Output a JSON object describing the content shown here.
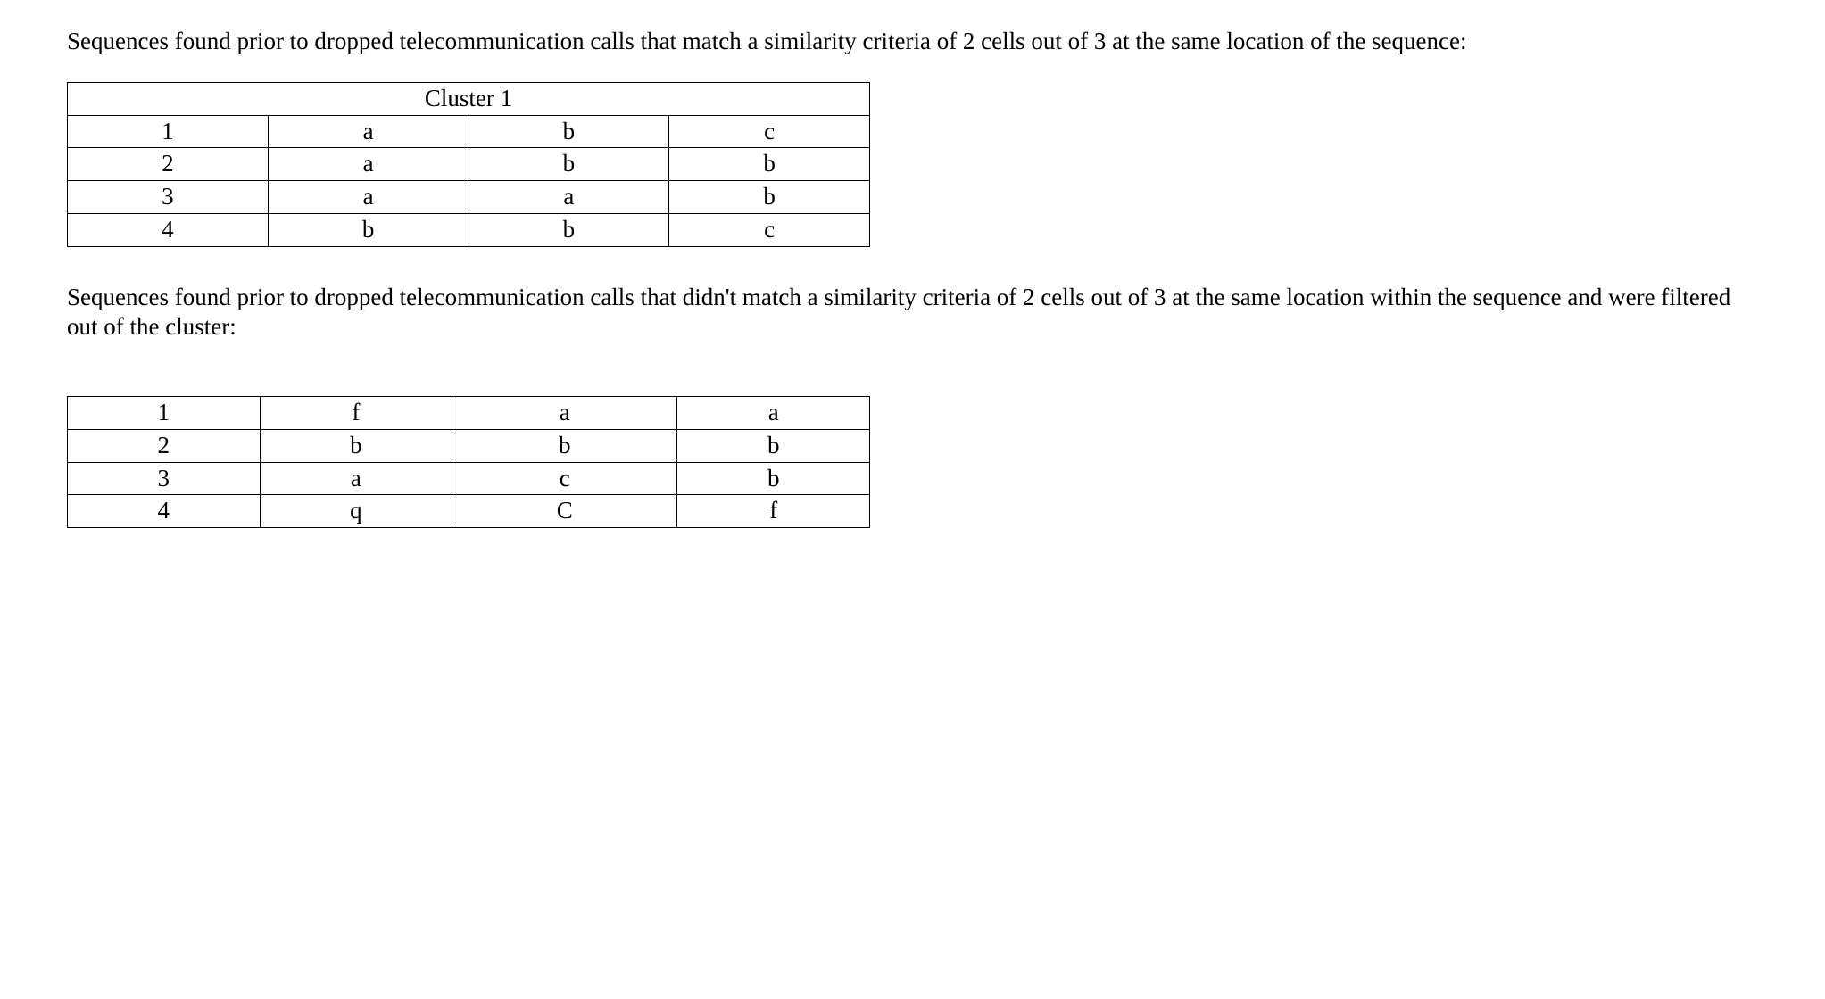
{
  "paragraph1": "Sequences found prior to dropped telecommunication calls that match a similarity criteria of 2 cells out of 3 at the same location of the sequence:",
  "table1": {
    "header": "Cluster 1",
    "rows": [
      [
        "1",
        "a",
        "b",
        "c"
      ],
      [
        "2",
        "a",
        "b",
        "b"
      ],
      [
        "3",
        "a",
        "a",
        "b"
      ],
      [
        "4",
        "b",
        "b",
        "c"
      ]
    ]
  },
  "paragraph2": "Sequences found prior to dropped telecommunication calls that didn't match a similarity criteria of 2 cells out of 3 at the same location within the sequence and were filtered out of the cluster:",
  "table2": {
    "rows": [
      [
        "1",
        "f",
        "a",
        "a"
      ],
      [
        "2",
        "b",
        "b",
        "b"
      ],
      [
        "3",
        "a",
        "c",
        "b"
      ],
      [
        "4",
        "q",
        "C",
        "f"
      ]
    ]
  }
}
